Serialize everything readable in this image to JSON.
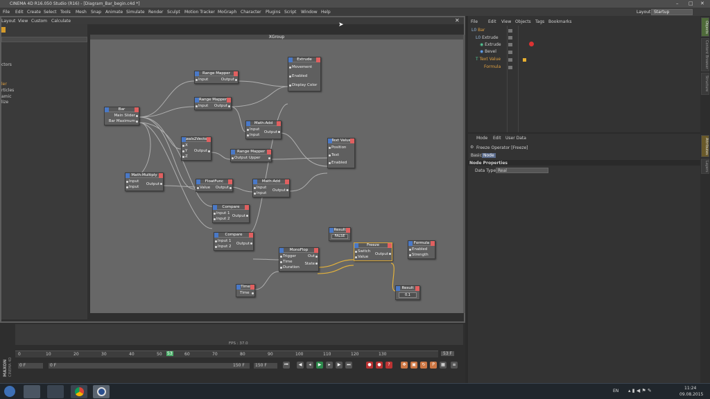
{
  "window": {
    "title": "CINEMA 4D R16.050 Studio (R16) - [Diagram_Bar_begin.c4d *]"
  },
  "menubar": [
    "File",
    "Edit",
    "Create",
    "Select",
    "Tools",
    "Mesh",
    "Snap",
    "Animate",
    "Simulate",
    "Render",
    "Sculpt",
    "Motion Tracker",
    "MoGraph",
    "Character",
    "Plugins",
    "Script",
    "Window",
    "Help"
  ],
  "layout": {
    "label": "Layout:",
    "value": "Startup"
  },
  "xpresso": {
    "menu": [
      "Layout",
      "View",
      "Custom",
      "Calculate"
    ],
    "group_title": "XGroup",
    "nodes": {
      "extrude": {
        "title": "Extrude",
        "ports": [
          "Movement",
          "Enabled",
          "Display Color"
        ]
      },
      "range1": {
        "title": "Range Mapper",
        "in": "Input",
        "out": "Output"
      },
      "range2": {
        "title": "Range Mapper",
        "in": "Input",
        "out": "Output"
      },
      "bar": {
        "title": "Bar",
        "ports": [
          "Main Slider",
          "Bar Maximum"
        ]
      },
      "mathadd1": {
        "title": "Math:Add",
        "in1": "Input",
        "in2": "Input",
        "out": "Output"
      },
      "reals2vector": {
        "title": "Reals2Vector",
        "x": "X",
        "y": "Y",
        "z": "Z",
        "out": "Output"
      },
      "range3": {
        "title": "Range Mapper",
        "out": "Output Upper"
      },
      "textvalue": {
        "title": "Text Value",
        "ports": [
          "Position",
          "Text",
          "Enabled"
        ]
      },
      "mathmultiply": {
        "title": "Math:Multiply",
        "in1": "Input",
        "in2": "Input",
        "out": "Output"
      },
      "floatfunc": {
        "title": "FloatFunc",
        "in": "Value",
        "out": "Output"
      },
      "mathadd2": {
        "title": "Math:Add",
        "in1": "Input",
        "in2": "Input",
        "out": "Output"
      },
      "compare1": {
        "title": "Compare",
        "in1": "Input 1",
        "in2": "Input 2",
        "out": "Output"
      },
      "compare2": {
        "title": "Compare",
        "in1": "Input 1",
        "in2": "Input 2",
        "out": "Output"
      },
      "result1": {
        "title": "Result",
        "value": "FALSE"
      },
      "monoflop": {
        "title": "MonoFlop",
        "ports": [
          "Trigger",
          "Time",
          "Duration"
        ],
        "outs": [
          "Out",
          "State"
        ]
      },
      "freeze": {
        "title": "Freeze",
        "ports": [
          "Switch",
          "Value"
        ],
        "out": "Output"
      },
      "formula": {
        "title": "Formula",
        "ports": [
          "Enabled",
          "Strength"
        ]
      },
      "time": {
        "title": "Time",
        "out": "Time"
      },
      "result2": {
        "title": "Result",
        "value": "0.1"
      }
    }
  },
  "left_list": [
    "ctors",
    "ler",
    "rticles",
    "amic",
    "lize"
  ],
  "object_manager": {
    "menu": [
      "File",
      "Edit",
      "View",
      "Objects",
      "Tags",
      "Bookmarks"
    ],
    "objects": [
      "Bar",
      "Extrude",
      "Extrude",
      "Bevel",
      "Text Value",
      "Formula"
    ]
  },
  "attribute_manager": {
    "menu": [
      "Mode",
      "Edit",
      "User Data"
    ],
    "operator": "Freeze Operator [Freeze]",
    "tabs": [
      "Basic",
      "Node"
    ],
    "section": "Node Properties",
    "field_label": "Data Type",
    "field_value": "Real"
  },
  "right_tabs": [
    "Objects",
    "Content Browser",
    "Structure",
    "Attributes",
    "Layers"
  ],
  "timeline": {
    "fps": "FPS : 37.0",
    "ticks": [
      "0",
      "10",
      "20",
      "30",
      "40",
      "50",
      "60",
      "70",
      "80",
      "90",
      "100",
      "110",
      "120",
      "130"
    ],
    "marker": "53",
    "end_frame": "53 F",
    "start": "0 F",
    "field1": "0 F",
    "field2": "150 F",
    "field3": "150 F"
  },
  "logo": {
    "line1": "MAXON",
    "line2": "CINEMA 4D"
  },
  "taskbar": {
    "lang": "EN",
    "time": "11:24",
    "date": "09.08.2015"
  }
}
